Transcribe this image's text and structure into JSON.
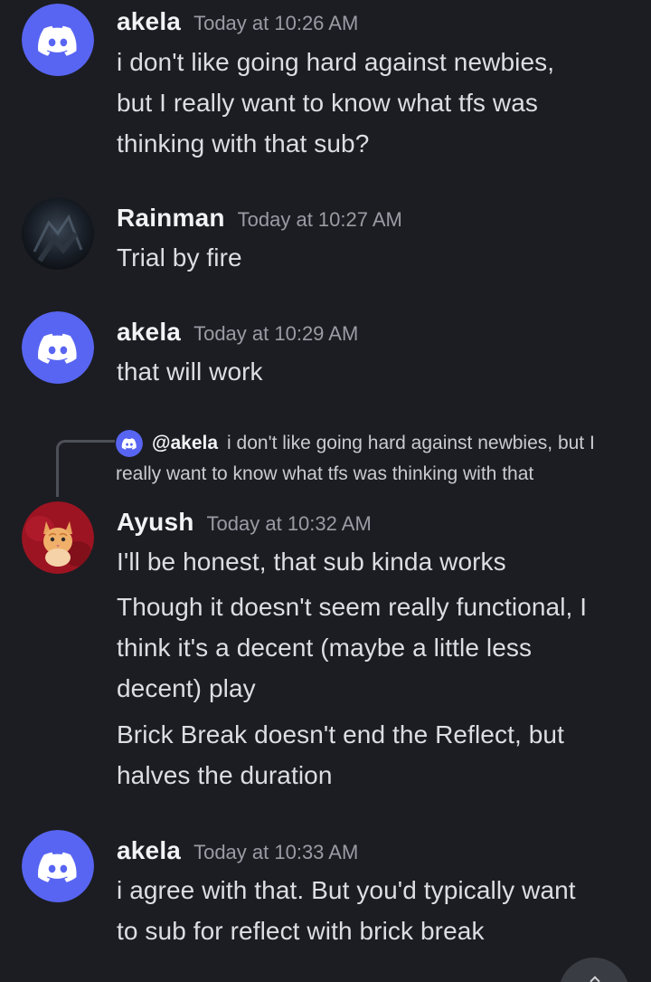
{
  "messages": [
    {
      "author": "akela",
      "timestamp": "Today at 10:26 AM",
      "avatar": "discord-default-avatar",
      "lines": [
        "i don't like going hard against newbies,",
        "but I really want to know what tfs was",
        "thinking with that sub?"
      ]
    },
    {
      "author": "Rainman",
      "timestamp": "Today at 10:27 AM",
      "avatar": "dark-photo-avatar",
      "lines": [
        "Trial by fire"
      ]
    },
    {
      "author": "akela",
      "timestamp": "Today at 10:29 AM",
      "avatar": "discord-default-avatar",
      "lines": [
        "that will work"
      ]
    },
    {
      "author": "Ayush",
      "timestamp": "Today at 10:32 AM",
      "avatar": "cat-photo-avatar",
      "reply": {
        "mention": "@akela",
        "text": "i don't like going hard against newbies, but I really want to know what tfs was thinking with that"
      },
      "lines": [
        "I'll be honest, that sub kinda works",
        "Though it doesn't seem really functional, I",
        "think it's a decent (maybe a little less",
        "decent) play",
        "Brick Break doesn't end the Reflect, but",
        "halves the duration"
      ]
    },
    {
      "author": "akela",
      "timestamp": "Today at 10:33 AM",
      "avatar": "discord-default-avatar",
      "lines": [
        "i agree with that. But you'd typically want",
        "to sub for reflect with brick break"
      ]
    }
  ],
  "colors": {
    "background": "#1c1d22",
    "blurple": "#5865f2",
    "text": "#dcdee2",
    "timestamp": "#9a9ca5"
  },
  "scroll_button_icon": "chevron-up-icon"
}
